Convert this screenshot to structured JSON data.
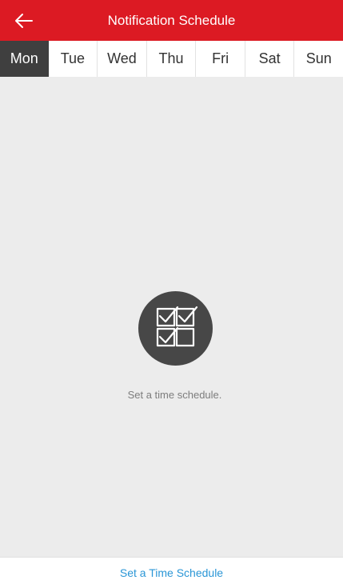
{
  "header": {
    "title": "Notification Schedule",
    "back_icon": "arrow-left-icon",
    "background": "#dc1a23"
  },
  "tabs": [
    {
      "label": "Mon",
      "active": true
    },
    {
      "label": "Tue",
      "active": false
    },
    {
      "label": "Wed",
      "active": false
    },
    {
      "label": "Thu",
      "active": false
    },
    {
      "label": "Fri",
      "active": false
    },
    {
      "label": "Sat",
      "active": false
    },
    {
      "label": "Sun",
      "active": false
    }
  ],
  "empty_state": {
    "icon": "schedule-checklist-icon",
    "message": "Set a time schedule."
  },
  "footer": {
    "action_label": "Set a Time Schedule",
    "action_color": "#2a96d6"
  }
}
